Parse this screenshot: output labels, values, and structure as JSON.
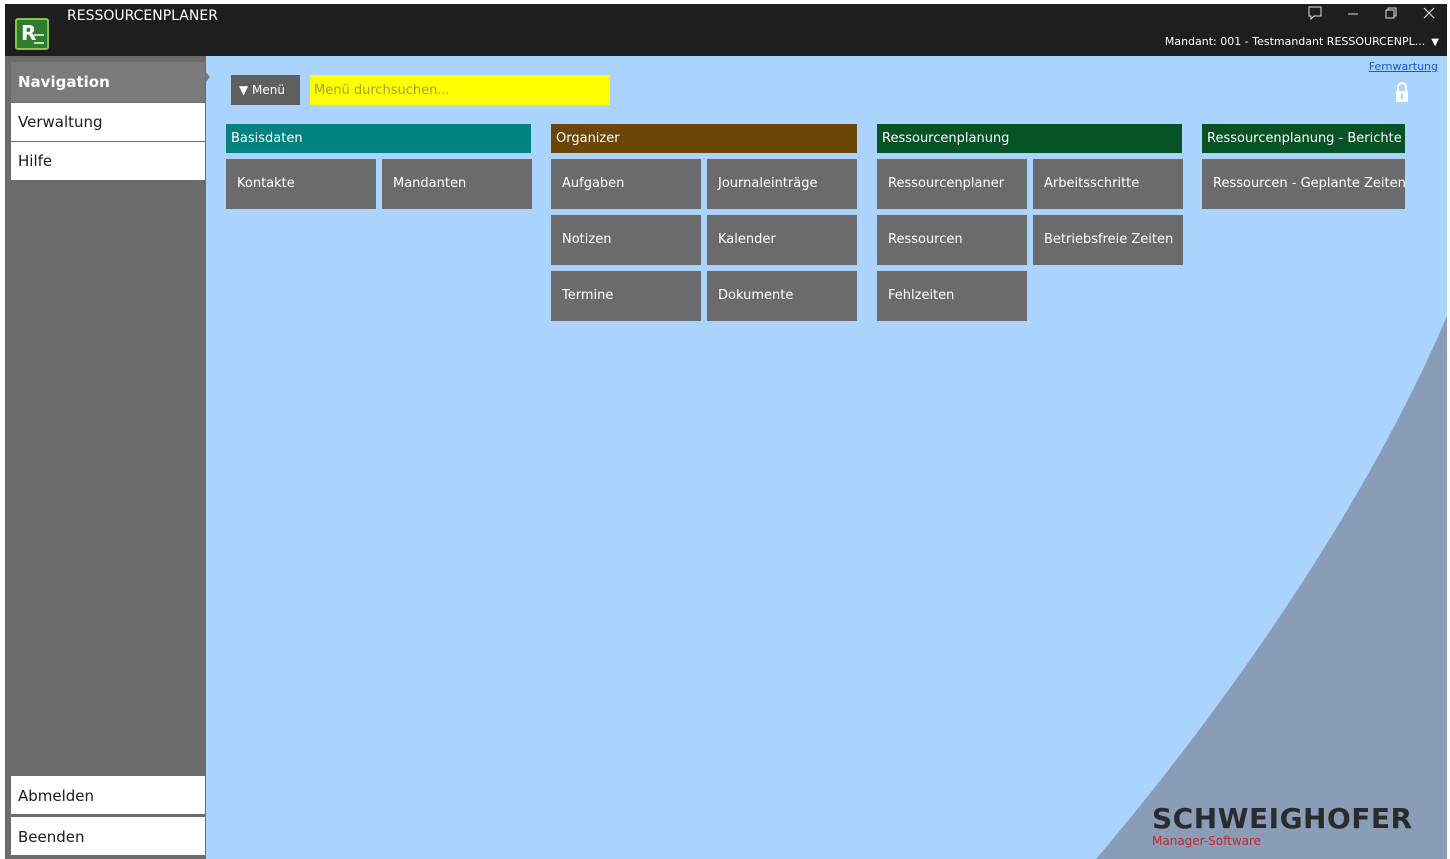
{
  "window": {
    "title": "RESSOURCENPLANER",
    "icon_letter": "R",
    "controls": [
      "feedback-icon",
      "minimize-icon",
      "restore-icon",
      "close-icon"
    ],
    "mandant": "Mandant: 001 - Testmandant RESSOURCENPL..."
  },
  "sidebar": {
    "items": [
      {
        "label": "Navigation",
        "active": true
      },
      {
        "label": "Verwaltung",
        "active": false
      },
      {
        "label": "Hilfe",
        "active": false
      }
    ],
    "bottom": [
      {
        "label": "Abmelden"
      },
      {
        "label": "Beenden"
      }
    ]
  },
  "toolbar": {
    "menu_label": "▼ Menü",
    "search_placeholder": "Menü durchsuchen...",
    "remote_link": "Fernwartung"
  },
  "groups": [
    {
      "title": "Basisdaten",
      "color": "#00827f",
      "tiles": [
        "Kontakte",
        "Mandanten"
      ]
    },
    {
      "title": "Organizer",
      "color": "#6b4606",
      "tiles": [
        "Aufgaben",
        "Journaleinträge",
        "Notizen",
        "Kalender",
        "Termine",
        "Dokumente"
      ]
    },
    {
      "title": "Ressourcenplanung",
      "color": "#075325",
      "tiles": [
        "Ressourcenplaner",
        "Arbeitsschritte",
        "Ressourcen",
        "Betriebsfreie Zeiten",
        "Fehlzeiten"
      ]
    },
    {
      "title": "Ressourcenplanung - Berichte",
      "color": "#075325",
      "tiles": [
        "Ressourcen - Geplante Zeiten"
      ]
    }
  ],
  "branding": {
    "name": "SCHWEIGHOFER",
    "tagline": "Manager-Software"
  },
  "colors": {
    "background": "#aad4fe",
    "tile": "#6b6b6b",
    "search": "#ffff00",
    "titlebar": "#1e1e1e"
  }
}
